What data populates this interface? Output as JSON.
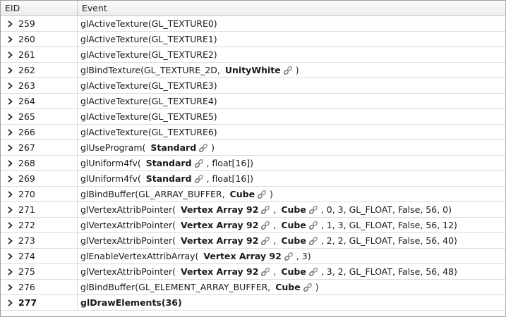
{
  "headers": {
    "eid": "EID",
    "event": "Event"
  },
  "rows": [
    {
      "eid": "259",
      "parts": [
        {
          "t": "glActiveTexture(GL_TEXTURE0)"
        }
      ]
    },
    {
      "eid": "260",
      "parts": [
        {
          "t": "glActiveTexture(GL_TEXTURE1)"
        }
      ]
    },
    {
      "eid": "261",
      "parts": [
        {
          "t": "glActiveTexture(GL_TEXTURE2)"
        }
      ]
    },
    {
      "eid": "262",
      "parts": [
        {
          "t": "glBindTexture(GL_TEXTURE_2D, "
        },
        {
          "r": "UnityWhite"
        },
        {
          "t": " )"
        }
      ]
    },
    {
      "eid": "263",
      "parts": [
        {
          "t": "glActiveTexture(GL_TEXTURE3)"
        }
      ]
    },
    {
      "eid": "264",
      "parts": [
        {
          "t": "glActiveTexture(GL_TEXTURE4)"
        }
      ]
    },
    {
      "eid": "265",
      "parts": [
        {
          "t": "glActiveTexture(GL_TEXTURE5)"
        }
      ]
    },
    {
      "eid": "266",
      "parts": [
        {
          "t": "glActiveTexture(GL_TEXTURE6)"
        }
      ]
    },
    {
      "eid": "267",
      "parts": [
        {
          "t": "glUseProgram( "
        },
        {
          "r": "Standard"
        },
        {
          "t": " )"
        }
      ]
    },
    {
      "eid": "268",
      "parts": [
        {
          "t": "glUniform4fv( "
        },
        {
          "r": "Standard"
        },
        {
          "t": " , float[16])"
        }
      ]
    },
    {
      "eid": "269",
      "parts": [
        {
          "t": "glUniform4fv( "
        },
        {
          "r": "Standard"
        },
        {
          "t": " , float[16])"
        }
      ]
    },
    {
      "eid": "270",
      "parts": [
        {
          "t": "glBindBuffer(GL_ARRAY_BUFFER, "
        },
        {
          "r": "Cube"
        },
        {
          "t": " )"
        }
      ]
    },
    {
      "eid": "271",
      "parts": [
        {
          "t": "glVertexAttribPointer( "
        },
        {
          "r": "Vertex Array 92"
        },
        {
          "t": " , "
        },
        {
          "r": "Cube"
        },
        {
          "t": " , 0, 3, GL_FLOAT, False, 56, 0)"
        }
      ]
    },
    {
      "eid": "272",
      "parts": [
        {
          "t": "glVertexAttribPointer( "
        },
        {
          "r": "Vertex Array 92"
        },
        {
          "t": " , "
        },
        {
          "r": "Cube"
        },
        {
          "t": " , 1, 3, GL_FLOAT, False, 56, 12)"
        }
      ]
    },
    {
      "eid": "273",
      "parts": [
        {
          "t": "glVertexAttribPointer( "
        },
        {
          "r": "Vertex Array 92"
        },
        {
          "t": " , "
        },
        {
          "r": "Cube"
        },
        {
          "t": " , 2, 2, GL_FLOAT, False, 56, 40)"
        }
      ]
    },
    {
      "eid": "274",
      "parts": [
        {
          "t": "glEnableVertexAttribArray( "
        },
        {
          "r": "Vertex Array 92"
        },
        {
          "t": " , 3)"
        }
      ]
    },
    {
      "eid": "275",
      "parts": [
        {
          "t": "glVertexAttribPointer( "
        },
        {
          "r": "Vertex Array 92"
        },
        {
          "t": " , "
        },
        {
          "r": "Cube"
        },
        {
          "t": " , 3, 2, GL_FLOAT, False, 56, 48)"
        }
      ]
    },
    {
      "eid": "276",
      "parts": [
        {
          "t": "glBindBuffer(GL_ELEMENT_ARRAY_BUFFER, "
        },
        {
          "r": "Cube"
        },
        {
          "t": " )"
        }
      ]
    },
    {
      "eid": "277",
      "bold": true,
      "parts": [
        {
          "t": "glDrawElements(36)"
        }
      ]
    }
  ],
  "icons": {
    "expand": "chevron-right-icon",
    "resource_link": "link-icon"
  },
  "colors": {
    "header_bg": "#ededed",
    "grid": "#dadada",
    "text": "#1a1a1a"
  }
}
